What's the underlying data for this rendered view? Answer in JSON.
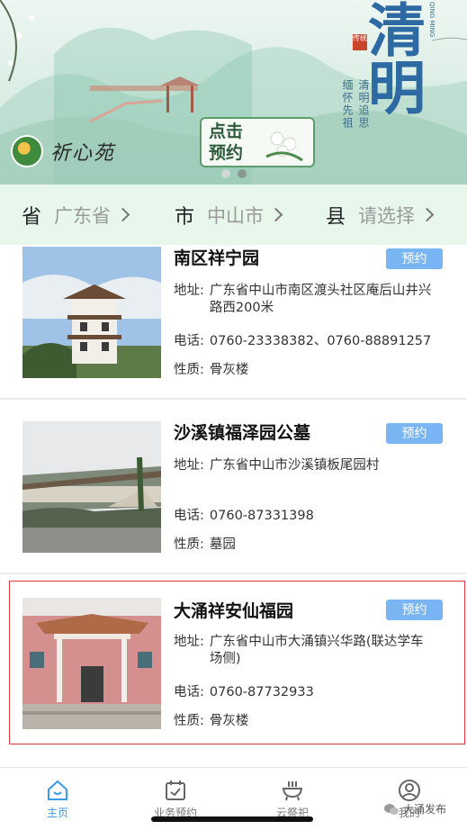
{
  "banner": {
    "brand_name": "祈心苑",
    "book_card_text": "点击预约",
    "festival_title": "清明",
    "festival_pinyin": "QING MING",
    "seal_text": "传统",
    "couplet_left": "缅怀先祖",
    "couplet_right": "清明追思",
    "carousel_active_index": 1
  },
  "region": {
    "province_label": "省",
    "province_value": "广东省",
    "city_label": "市",
    "city_value": "中山市",
    "county_label": "县",
    "county_value": "请选择"
  },
  "cemeteries": [
    {
      "name": "南区祥宁园",
      "book_label": "预约",
      "address_label": "地址:",
      "address": "广东省中山市南区渡头社区庵后山井兴路西200米",
      "phone_label": "电话:",
      "phone": "0760-23338382、0760-88891257",
      "type_label": "性质:",
      "type": "骨灰楼"
    },
    {
      "name": "沙溪镇福泽园公墓",
      "book_label": "预约",
      "address_label": "地址:",
      "address": "广东省中山市沙溪镇板尾园村",
      "phone_label": "电话:",
      "phone": "0760-87331398",
      "type_label": "性质:",
      "type": "墓园"
    },
    {
      "name": "大涌祥安仙福园",
      "book_label": "预约",
      "address_label": "地址:",
      "address": "广东省中山市大涌镇兴华路(联达学车场侧)",
      "phone_label": "电话:",
      "phone": "0760-87732933",
      "type_label": "性质:",
      "type": "骨灰楼"
    }
  ],
  "tabbar": {
    "home": "主页",
    "booking": "业务预约",
    "cloud": "云祭祀",
    "mine": "我的"
  },
  "watermark": "大涌发布",
  "colors": {
    "accent": "#79b5f2",
    "active_tab": "#3d9ae8",
    "region_bg": "#e8f7ec",
    "highlight": "#e23a3a"
  }
}
